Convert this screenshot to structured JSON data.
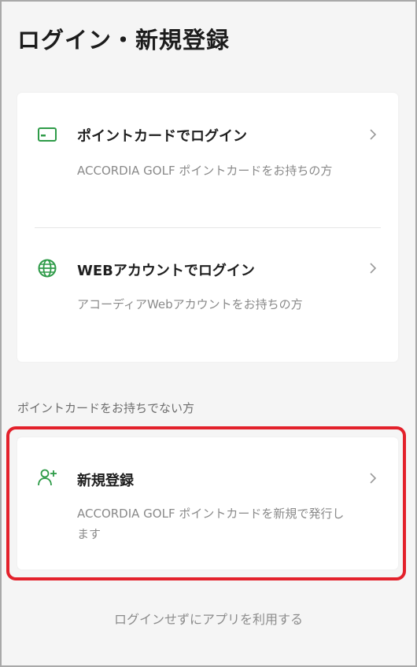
{
  "header": {
    "title": "ログイン・新規登録"
  },
  "login_options": [
    {
      "label": "ポイントカードでログイン",
      "description": "ACCORDIA GOLF ポイントカードをお持ちの方",
      "icon": "card-icon"
    },
    {
      "label": "WEBアカウントでログイン",
      "description": "アコーディアWebアカウントをお持ちの方",
      "icon": "globe-icon"
    }
  ],
  "no_card_section": {
    "label": "ポイントカードをお持ちでない方",
    "register": {
      "label": "新規登録",
      "description": "ACCORDIA GOLF ポイントカードを新規で発行します",
      "icon": "add-user-icon"
    }
  },
  "skip_link": "ログインせずにアプリを利用する",
  "colors": {
    "accent": "#2e9b48",
    "highlight": "#e3212b",
    "background": "#f5f5f5"
  }
}
